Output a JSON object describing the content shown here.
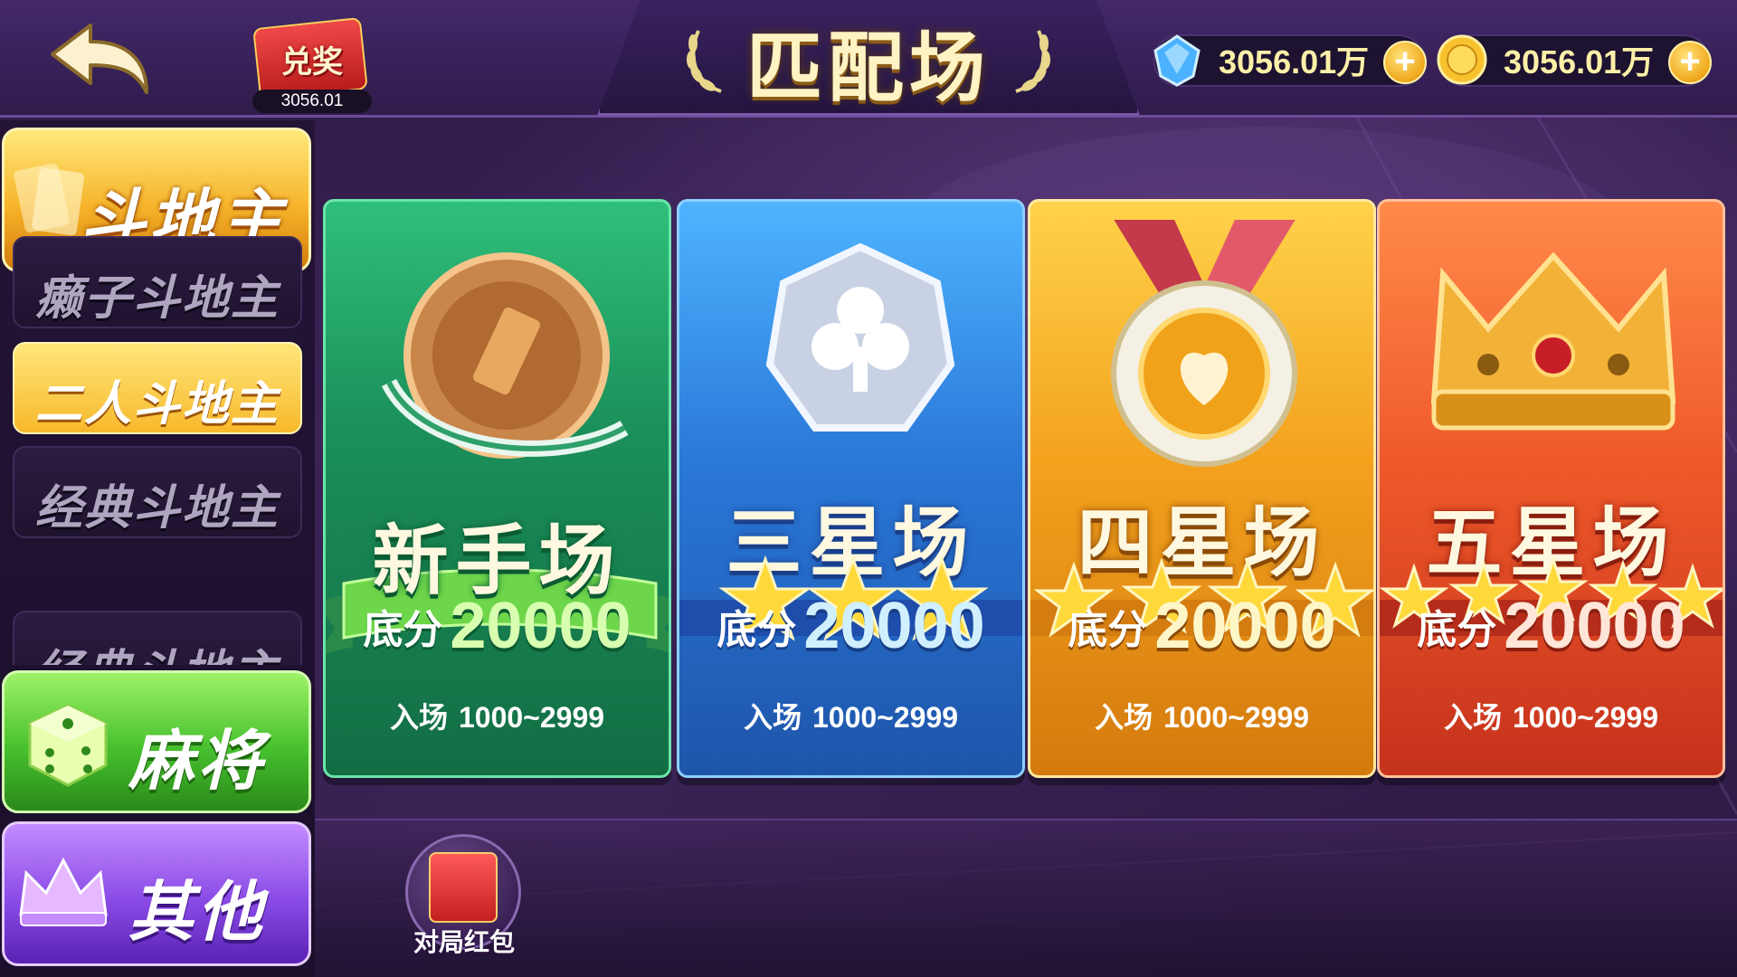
{
  "header": {
    "title": "匹配场",
    "redeem": {
      "label": "兑奖",
      "amount": "3056.01"
    },
    "currencies": [
      {
        "icon": "diamond-icon",
        "value": "3056.01万"
      },
      {
        "icon": "gold-coin-icon",
        "value": "3056.01万"
      }
    ]
  },
  "sidebar": {
    "main_category": "斗地主",
    "sub_categories": [
      "癞子斗地主",
      "二人斗地主",
      "经典斗地主",
      "经典斗地主"
    ],
    "active_sub_index": 1,
    "other_categories": [
      "麻将",
      "其他"
    ]
  },
  "rooms": [
    {
      "name": "新手场",
      "stars": 0,
      "base_label": "底分",
      "base_value": "20000",
      "entry_label": "入场",
      "entry_range": "1000~2999",
      "emblem": "bronze-coin-icon"
    },
    {
      "name": "三星场",
      "stars": 3,
      "base_label": "底分",
      "base_value": "20000",
      "entry_label": "入场",
      "entry_range": "1000~2999",
      "emblem": "silver-club-badge-icon"
    },
    {
      "name": "四星场",
      "stars": 4,
      "base_label": "底分",
      "base_value": "20000",
      "entry_label": "入场",
      "entry_range": "1000~2999",
      "emblem": "gold-medal-icon"
    },
    {
      "name": "五星场",
      "stars": 5,
      "base_label": "底分",
      "base_value": "20000",
      "entry_label": "入场",
      "entry_range": "1000~2999",
      "emblem": "crown-icon"
    }
  ],
  "footer": {
    "match_red_packet_label": "对局红包"
  },
  "colors": {
    "gold_accent": "#f7b42a",
    "green_room": "#1b8f5a",
    "blue_room": "#2a78d8",
    "yellow_room": "#f3a21e",
    "red_room": "#ef5a2a"
  }
}
